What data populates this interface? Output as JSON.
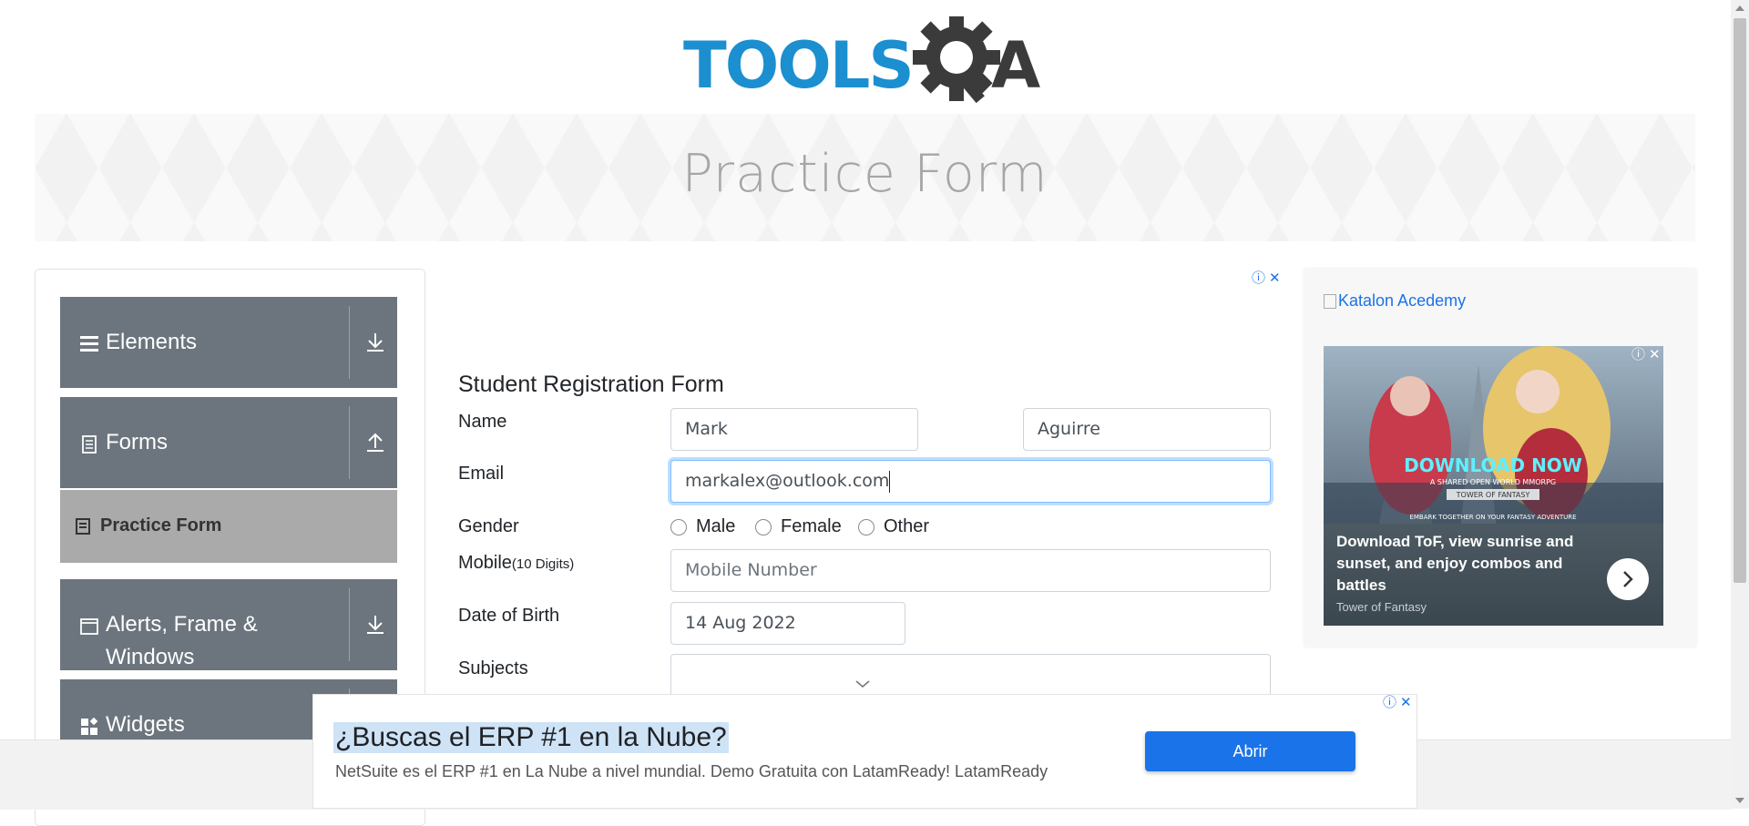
{
  "header": {
    "logo_alt": "TOOLSQA",
    "logo_text_left": "TOOLS",
    "logo_text_right": "A"
  },
  "banner": {
    "title": "Practice Form"
  },
  "sidebar": {
    "groups": [
      {
        "label": "Elements",
        "icon": "list-icon",
        "arrow": "download-arrow-icon"
      },
      {
        "label": "Forms",
        "icon": "document-icon",
        "arrow": "upload-arrow-icon",
        "items": [
          {
            "label": "Practice Form",
            "icon": "form-icon",
            "active": true
          }
        ]
      },
      {
        "label": "Alerts, Frame & Windows",
        "icon": "window-icon",
        "arrow": "download-arrow-icon"
      },
      {
        "label": "Widgets",
        "icon": "widgets-icon",
        "arrow": "download-arrow-icon"
      }
    ]
  },
  "form": {
    "title": "Student Registration Form",
    "name_label": "Name",
    "first_name": "Mark",
    "last_name": "Aguirre",
    "email_label": "Email",
    "email_value": "markalex@outlook.com",
    "gender_label": "Gender",
    "gender_options": [
      "Male",
      "Female",
      "Other"
    ],
    "mobile_label": "Mobile",
    "mobile_hint": "(10 Digits)",
    "mobile_placeholder": "Mobile Number",
    "dob_label": "Date of Birth",
    "dob_value": "14 Aug 2022",
    "subjects_label": "Subjects",
    "subjects_value": ""
  },
  "right_ad": {
    "image_alt": "Katalon Acedemy",
    "art_headline": "DOWNLOAD NOW",
    "art_sub": "A SHARED OPEN WORLD MMORPG",
    "art_title": "TOWER OF FANTASY",
    "art_tagline": "EMBARK TOGETHER ON YOUR FANTASY ADVENTURE",
    "headline": "Download ToF, view sunrise and sunset, and enjoy combos and battles",
    "brand": "Tower of Fantasy"
  },
  "bottom_ad": {
    "headline": "¿Buscas el ERP #1 en la Nube?",
    "description": "NetSuite es el ERP #1 en La Nube a nivel mundial. Demo Gratuita con LatamReady! LatamReady",
    "button": "Abrir"
  },
  "colors": {
    "brand_blue": "#1b8fd0",
    "logo_dark": "#3b3b3b",
    "sidebar_bg": "#6c757d",
    "active_item": "#aaaaaa",
    "link_blue": "#1a73e8"
  }
}
